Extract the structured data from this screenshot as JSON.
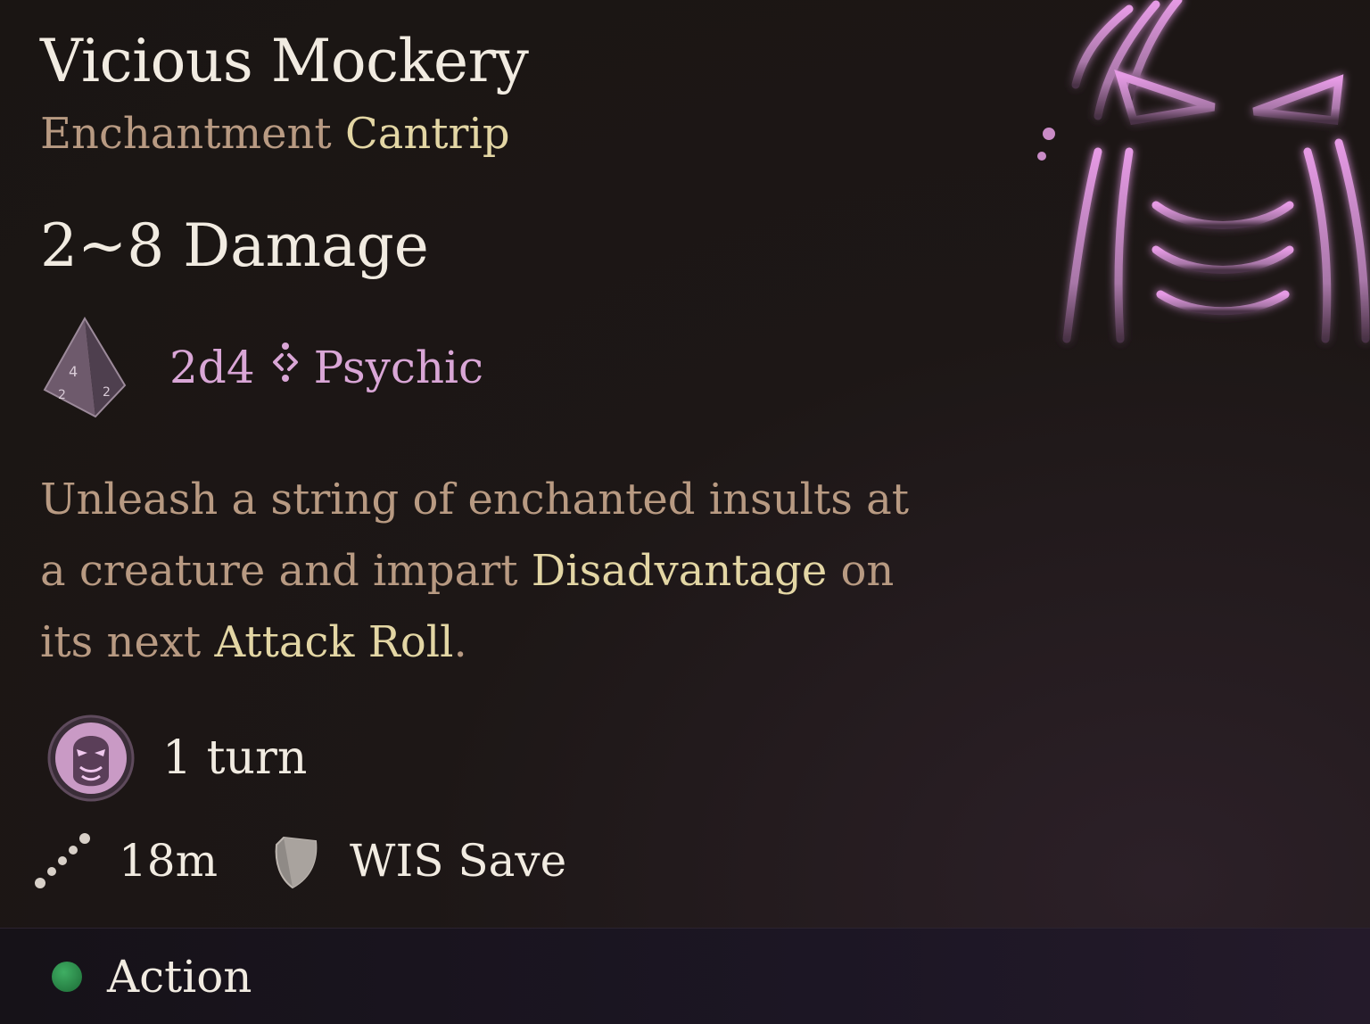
{
  "spell": {
    "name": "Vicious Mockery",
    "school": "Enchantment",
    "level": "Cantrip",
    "damage_summary": "2~8 Damage",
    "dice": "2d4",
    "damage_type": "Psychic",
    "description": {
      "part1": "Unleash a string of enchanted insults at a creature and impart ",
      "keyword1": "Disadvantage",
      "part2": " on its next ",
      "keyword2": "Attack Roll",
      "part3": "."
    },
    "duration": "1 turn",
    "range": "18m",
    "save": "WIS Save"
  },
  "footer": {
    "resource": "Action"
  },
  "colors": {
    "psychic": "#d9a6d6",
    "keyword": "#e3d6a4",
    "body_text": "#b89a82",
    "action_dot": "#2f8c4c"
  },
  "icons": [
    "spell-art-icon",
    "d4-dice-icon",
    "damage-type-separator-icon",
    "condition-icon",
    "range-icon",
    "save-shield-icon",
    "action-dot-icon"
  ]
}
